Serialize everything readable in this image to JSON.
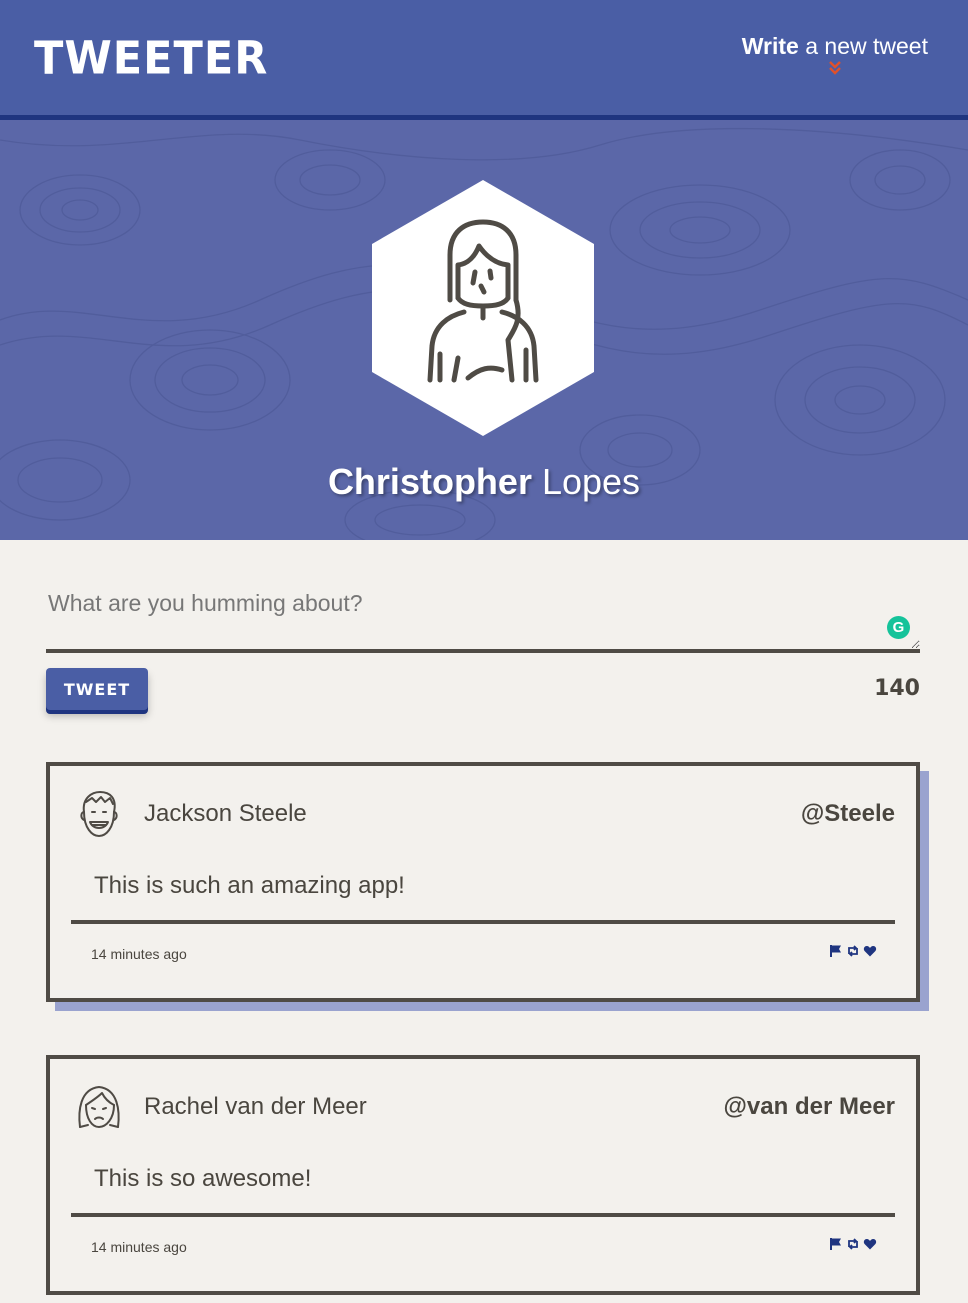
{
  "nav": {
    "logo": "TWEETER",
    "compose_bold": "Write",
    "compose_rest": " a new tweet"
  },
  "profile": {
    "first_name": "Christopher",
    "last_name": "Lopes"
  },
  "composer": {
    "placeholder": "What are you humming about?",
    "button_label": "TWEET",
    "char_count": "140",
    "grammarly_badge": "G"
  },
  "colors": {
    "nav_bg": "#4a5ea5",
    "accent_dark": "#1f3580",
    "chevron": "#e0512b",
    "text_dark": "#4a463f",
    "page_bg": "#f3f1ed"
  },
  "tweets": [
    {
      "name": "Jackson Steele",
      "handle": "@Steele",
      "content": "This is such an amazing app!",
      "time": "14 minutes ago",
      "avatar_icon": "smiling-man-avatar-icon"
    },
    {
      "name": "Rachel van der Meer",
      "handle": "@van der Meer",
      "content": "This is so awesome!",
      "time": "14 minutes ago",
      "avatar_icon": "woman-avatar-icon"
    }
  ],
  "action_icons": [
    "flag-icon",
    "retweet-icon",
    "heart-icon"
  ]
}
